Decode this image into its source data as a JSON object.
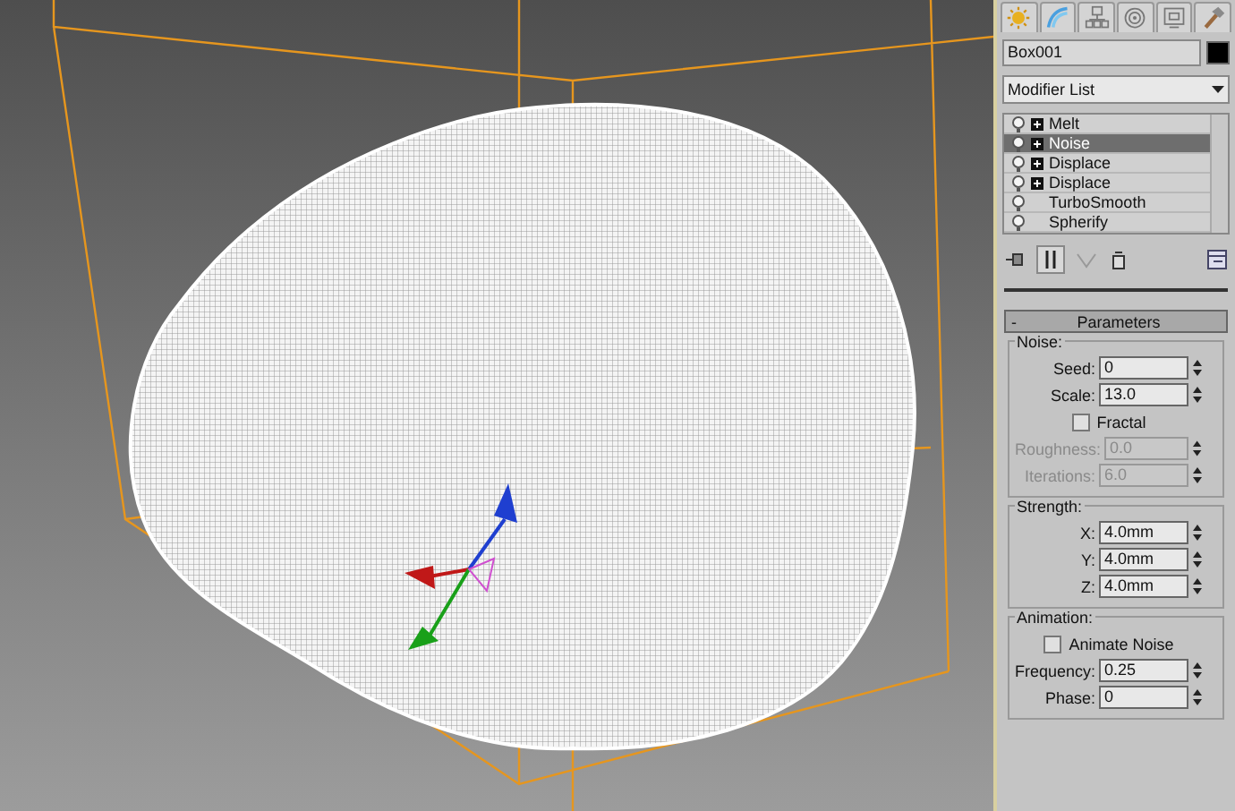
{
  "object_name": {
    "value": "Box001"
  },
  "modifier_dropdown": {
    "label": "Modifier List"
  },
  "modifier_stack": [
    {
      "label": "Melt",
      "expandable": true,
      "selected": false
    },
    {
      "label": "Noise",
      "expandable": true,
      "selected": true
    },
    {
      "label": "Displace",
      "expandable": true,
      "selected": false
    },
    {
      "label": "Displace",
      "expandable": true,
      "selected": false
    },
    {
      "label": "TurboSmooth",
      "expandable": false,
      "selected": false
    },
    {
      "label": "Spherify",
      "expandable": false,
      "selected": false
    }
  ],
  "rollout": {
    "toggle": "-",
    "title": "Parameters",
    "groups": [
      {
        "title": "Noise:",
        "items": [
          {
            "kind": "spinner",
            "label": "Seed:",
            "value": "0",
            "disabled": false
          },
          {
            "kind": "spinner",
            "label": "Scale:",
            "value": "13.0",
            "disabled": false
          },
          {
            "kind": "checkbox",
            "label": "Fractal",
            "checked": false
          },
          {
            "kind": "spinner",
            "label": "Roughness:",
            "value": "0.0",
            "disabled": true
          },
          {
            "kind": "spinner",
            "label": "Iterations:",
            "value": "6.0",
            "disabled": true
          }
        ]
      },
      {
        "title": "Strength:",
        "items": [
          {
            "kind": "spinner",
            "label": "X:",
            "value": "4.0mm",
            "disabled": false
          },
          {
            "kind": "spinner",
            "label": "Y:",
            "value": "4.0mm",
            "disabled": false
          },
          {
            "kind": "spinner",
            "label": "Z:",
            "value": "4.0mm",
            "disabled": false
          }
        ]
      },
      {
        "title": "Animation:",
        "items": [
          {
            "kind": "checkbox",
            "label": "Animate Noise",
            "checked": false
          },
          {
            "kind": "spinner",
            "label": "Frequency:",
            "value": "0.25",
            "disabled": false
          },
          {
            "kind": "spinner",
            "label": "Phase:",
            "value": "0",
            "disabled": false
          }
        ]
      }
    ]
  }
}
